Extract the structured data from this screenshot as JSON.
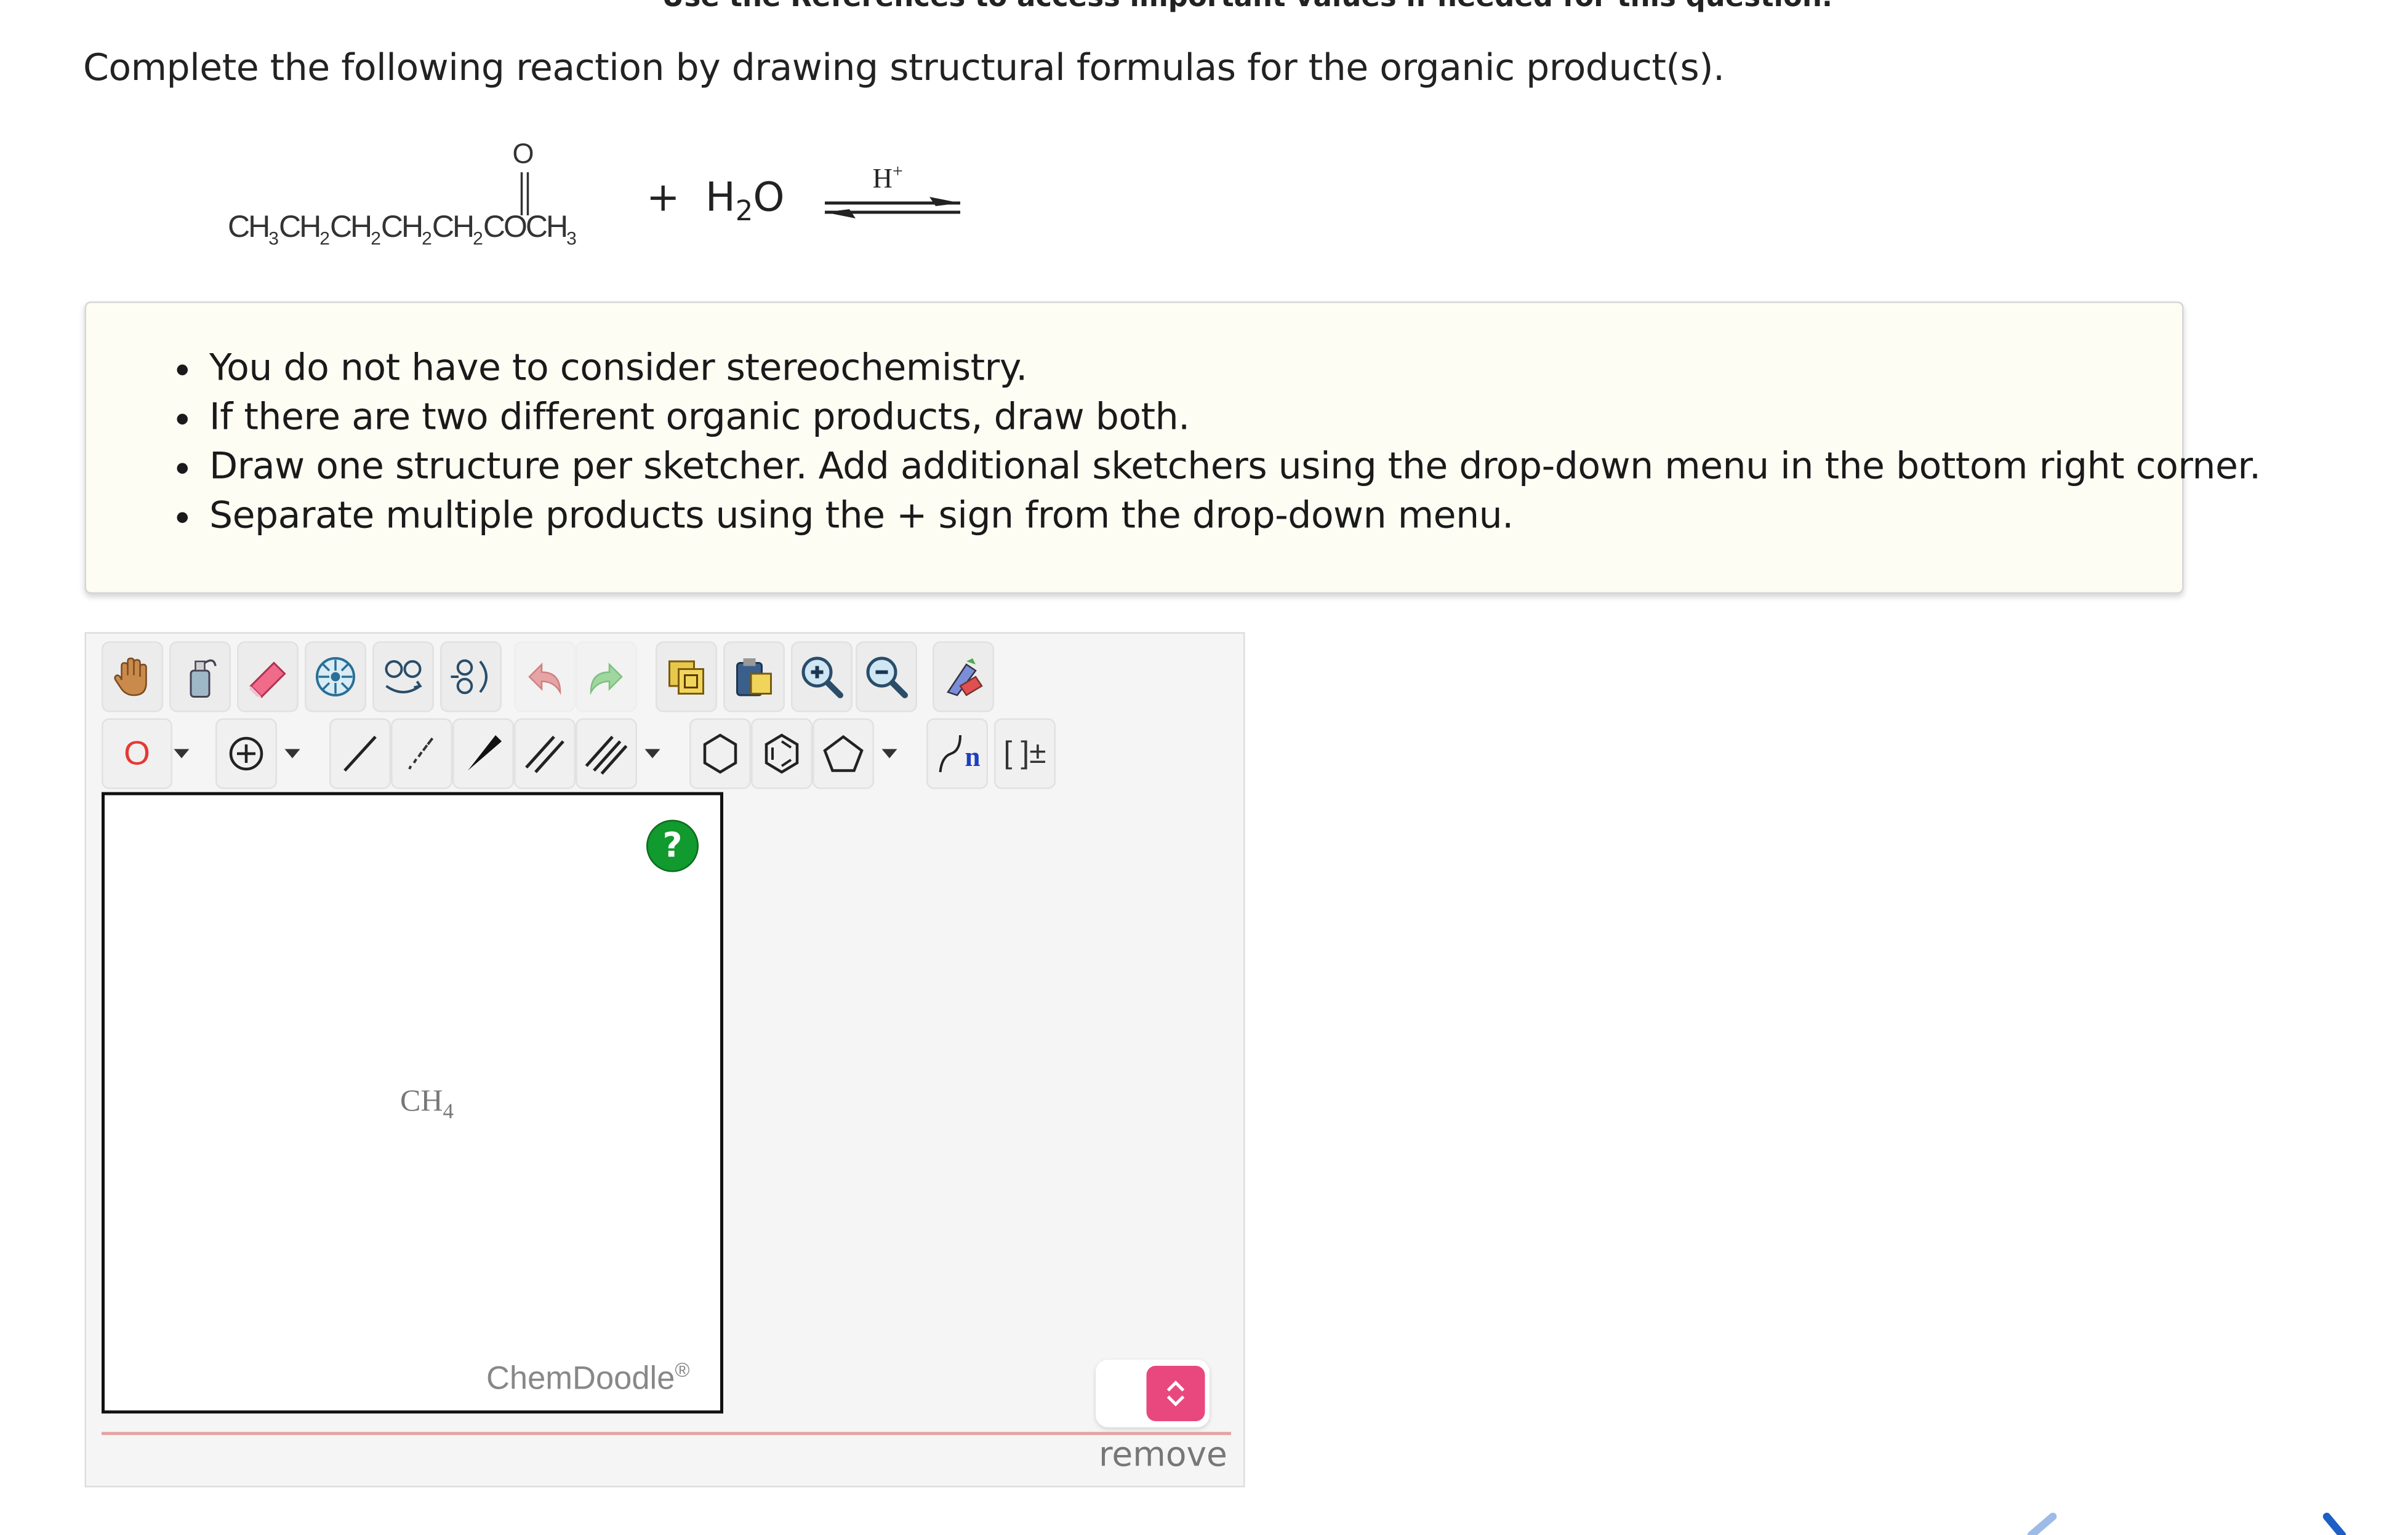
{
  "banner": "Use the References to access important values if needed for this question.",
  "question": "Complete the following reaction by drawing structural formulas for the organic product(s).",
  "reaction": {
    "reactant_carbonyl_o": "O",
    "reactant_parts": [
      "CH",
      "3",
      "CH",
      "2",
      "CH",
      "2",
      "CH",
      "2",
      "CH",
      "2",
      "COCH",
      "3"
    ],
    "plus": "+",
    "water_h": "H",
    "water_sub": "2",
    "water_o": "O",
    "catalyst": "H",
    "catalyst_sup": "+"
  },
  "hints": [
    "You do not have to consider stereochemistry.",
    "If there are two different organic products, draw both.",
    "Draw one structure per sketcher. Add additional sketchers using the drop-down menu in the bottom right corner.",
    "Separate multiple products using the + sign from the drop-down menu."
  ],
  "toolbar": {
    "atom_selector_value": "O",
    "icons_row1": [
      "hand-icon",
      "lasso-icon",
      "eraser-icon",
      "center-icon",
      "flip-icon",
      "rotate-icon",
      "undo-icon",
      "redo-icon",
      "copy-icon",
      "paste-icon",
      "zoom-in-icon",
      "zoom-out-icon",
      "clean-icon"
    ],
    "icons_row2": [
      "atom-selector",
      "charge-icon",
      "single-bond-icon",
      "hashed-bond-icon",
      "wedge-bond-icon",
      "double-bond-icon",
      "triple-bond-icon",
      "hexagon-icon",
      "benzene-icon",
      "pentagon-icon",
      "repeat-unit-icon",
      "bracket-icon"
    ],
    "repeat_label": "n",
    "bracket_label": "[ ]±"
  },
  "sketcher": {
    "help_label": "?",
    "placeholder_formula": "CH",
    "placeholder_sub": "4",
    "brand": "ChemDoodle",
    "brand_mark": "®"
  },
  "remove_label": "remove",
  "colors": {
    "hint_bg": "#fdfdf4",
    "help_green": "#119a2e",
    "add_button_pink": "#e8487e",
    "atom_red": "#e53935",
    "divider_red": "#e8a0a0"
  }
}
